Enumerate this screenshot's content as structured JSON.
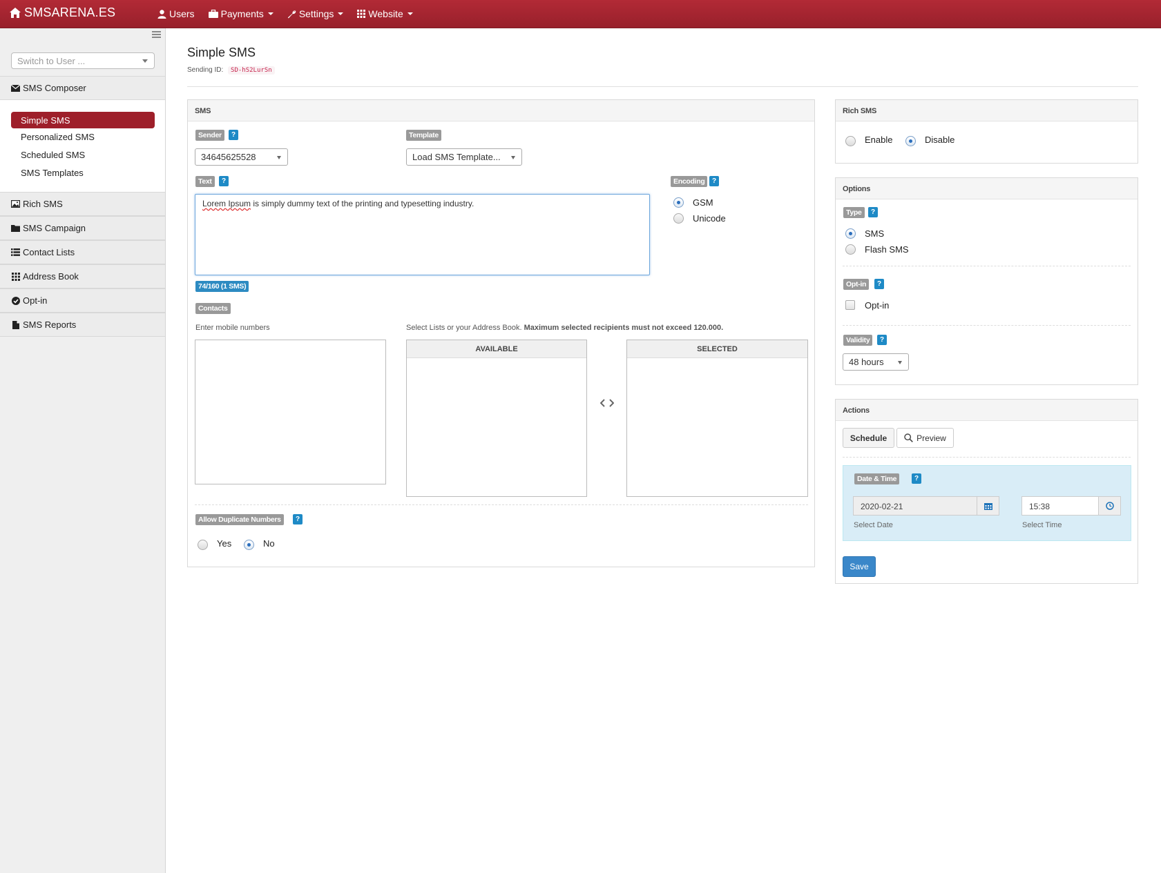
{
  "brand": "SMSARENA.ES",
  "nav": [
    {
      "label": "Users",
      "icon": "user-icon"
    },
    {
      "label": "Payments",
      "icon": "briefcase-icon"
    },
    {
      "label": "Settings",
      "icon": "wrench-icon"
    },
    {
      "label": "Website",
      "icon": "grid-icon"
    }
  ],
  "sidebar": {
    "switch_placeholder": "Switch to User ...",
    "composer": "SMS Composer",
    "sub_items": [
      "Simple SMS",
      "Personalized SMS",
      "Scheduled SMS",
      "SMS Templates"
    ],
    "sections": [
      "Rich SMS",
      "SMS Campaign",
      "Contact Lists",
      "Address Book",
      "Opt-in",
      "SMS Reports"
    ]
  },
  "page": {
    "title": "Simple SMS",
    "sending_id_label": "Sending ID:",
    "sending_id": "SD-hS2LurSn"
  },
  "sms_panel": {
    "title": "SMS",
    "sender_label": "Sender",
    "sender_value": "34645625528",
    "template_label": "Template",
    "template_value": "Load SMS Template...",
    "text_label": "Text",
    "text_spell": "Lorem Ipsum",
    "text_rest": " is simply dummy text of the printing and typesetting industry.",
    "counter": "74/160 (1 SMS)",
    "encoding_label": "Encoding",
    "encoding_options": [
      "GSM",
      "Unicode"
    ],
    "encoding_selected": "GSM",
    "contacts_label": "Contacts",
    "enter_numbers": "Enter mobile numbers",
    "select_lists_text": "Select Lists or your Address Book.",
    "select_lists_bold": "Maximum selected recipients must not exceed 120.000.",
    "available": "AVAILABLE",
    "selected": "SELECTED",
    "allow_dup_label": "Allow Duplicate Numbers",
    "dup_options": [
      "Yes",
      "No"
    ],
    "dup_selected": "No"
  },
  "rich_panel": {
    "title": "Rich SMS",
    "options": [
      "Enable",
      "Disable"
    ],
    "selected": "Disable"
  },
  "options_panel": {
    "title": "Options",
    "type_label": "Type",
    "type_options": [
      "SMS",
      "Flash SMS"
    ],
    "type_selected": "SMS",
    "optin_label": "Opt-in",
    "optin_checkbox": "Opt-in",
    "optin_checked": false,
    "validity_label": "Validity",
    "validity_value": "48 hours"
  },
  "actions_panel": {
    "title": "Actions",
    "schedule": "Schedule",
    "preview": "Preview",
    "datetime_label": "Date & Time",
    "date_value": "2020-02-21",
    "time_value": "15:38",
    "date_caption": "Select Date",
    "time_caption": "Select Time",
    "save": "Save"
  },
  "colors": {
    "brand_red": "#9e1f2a",
    "help_blue": "#1e8ac6",
    "save_blue": "#3a87c9",
    "datetime_bg": "#d9edf7"
  }
}
